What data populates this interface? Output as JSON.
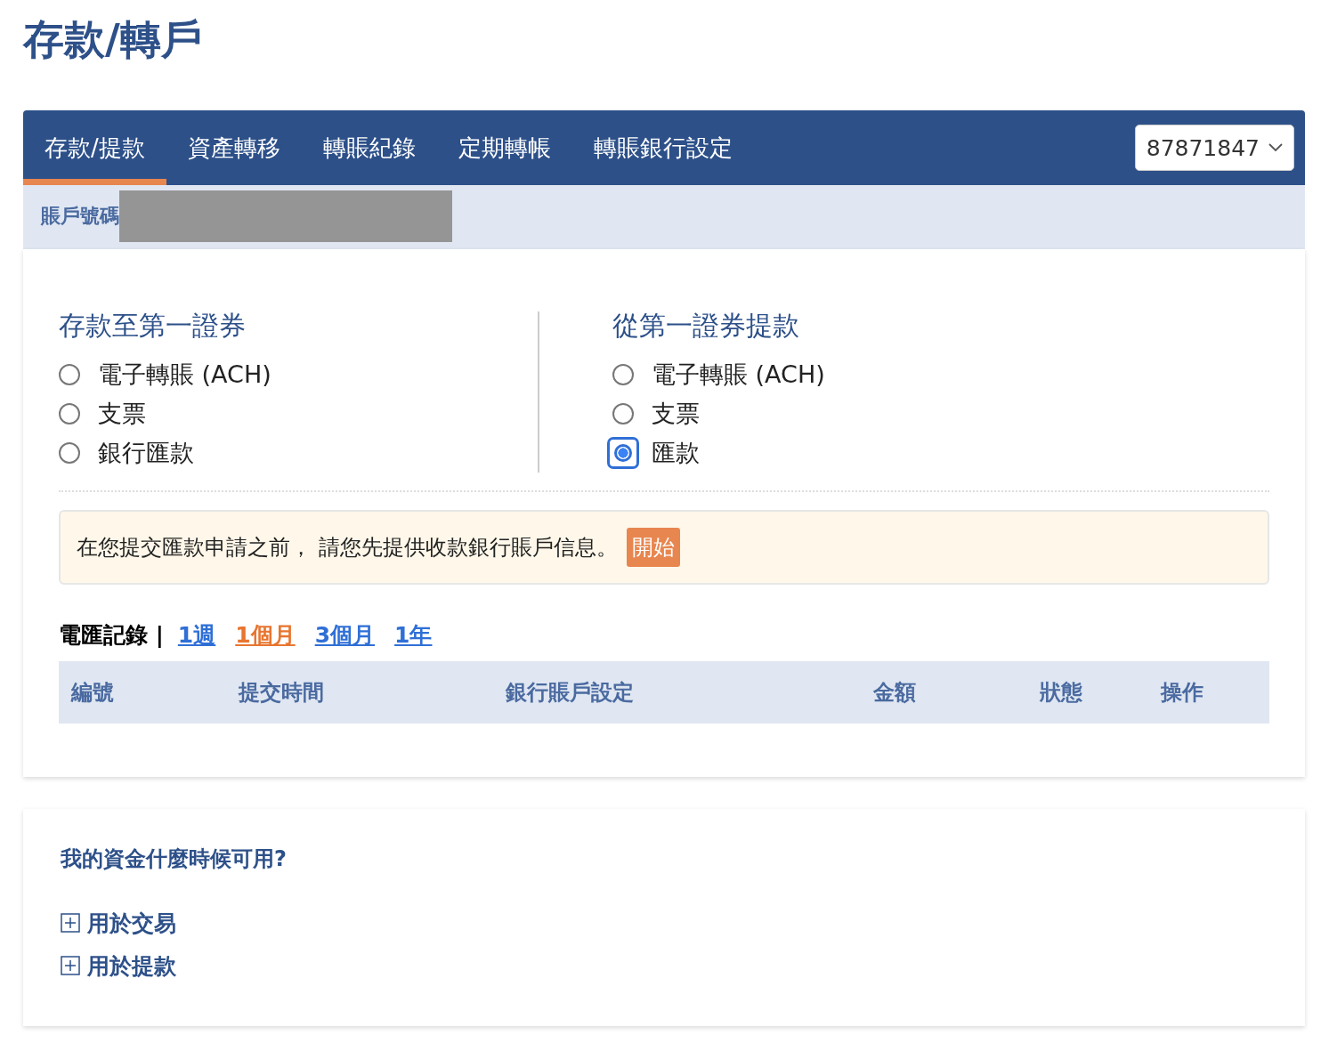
{
  "page_title": "存款/轉戶",
  "tabs": [
    {
      "label": "存款/提款",
      "selected": true
    },
    {
      "label": "資產轉移",
      "selected": false
    },
    {
      "label": "轉賬紀錄",
      "selected": false
    },
    {
      "label": "定期轉帳",
      "selected": false
    },
    {
      "label": "轉賬銀行設定",
      "selected": false
    }
  ],
  "account_select": {
    "value": "87871847"
  },
  "account_bar": {
    "label": "賬戶號碼"
  },
  "deposit": {
    "title": "存款至第一證券",
    "options": [
      {
        "label": "電子轉賬 (ACH)",
        "selected": false
      },
      {
        "label": "支票",
        "selected": false
      },
      {
        "label": "銀行匯款",
        "selected": false
      }
    ]
  },
  "withdraw": {
    "title": "從第一證券提款",
    "options": [
      {
        "label": "電子轉賬 (ACH)",
        "selected": false
      },
      {
        "label": "支票",
        "selected": false
      },
      {
        "label": "匯款",
        "selected": true
      }
    ]
  },
  "notice": {
    "text": "在您提交匯款申請之前， 請您先提供收款銀行賬戶信息。",
    "button": "開始"
  },
  "history": {
    "label": "電匯記錄 |",
    "ranges": [
      {
        "label": "1週",
        "selected": false
      },
      {
        "label": "1個月",
        "selected": true
      },
      {
        "label": "3個月",
        "selected": false
      },
      {
        "label": "1年",
        "selected": false
      }
    ]
  },
  "table": {
    "columns": [
      "編號",
      "提交時間",
      "銀行賬戶設定",
      "金額",
      "狀態",
      "操作"
    ]
  },
  "faq": {
    "title": "我的資金什麼時候可用?",
    "items": [
      {
        "label": "用於交易",
        "expanded": false
      },
      {
        "label": "用於提款",
        "expanded": false
      }
    ]
  }
}
